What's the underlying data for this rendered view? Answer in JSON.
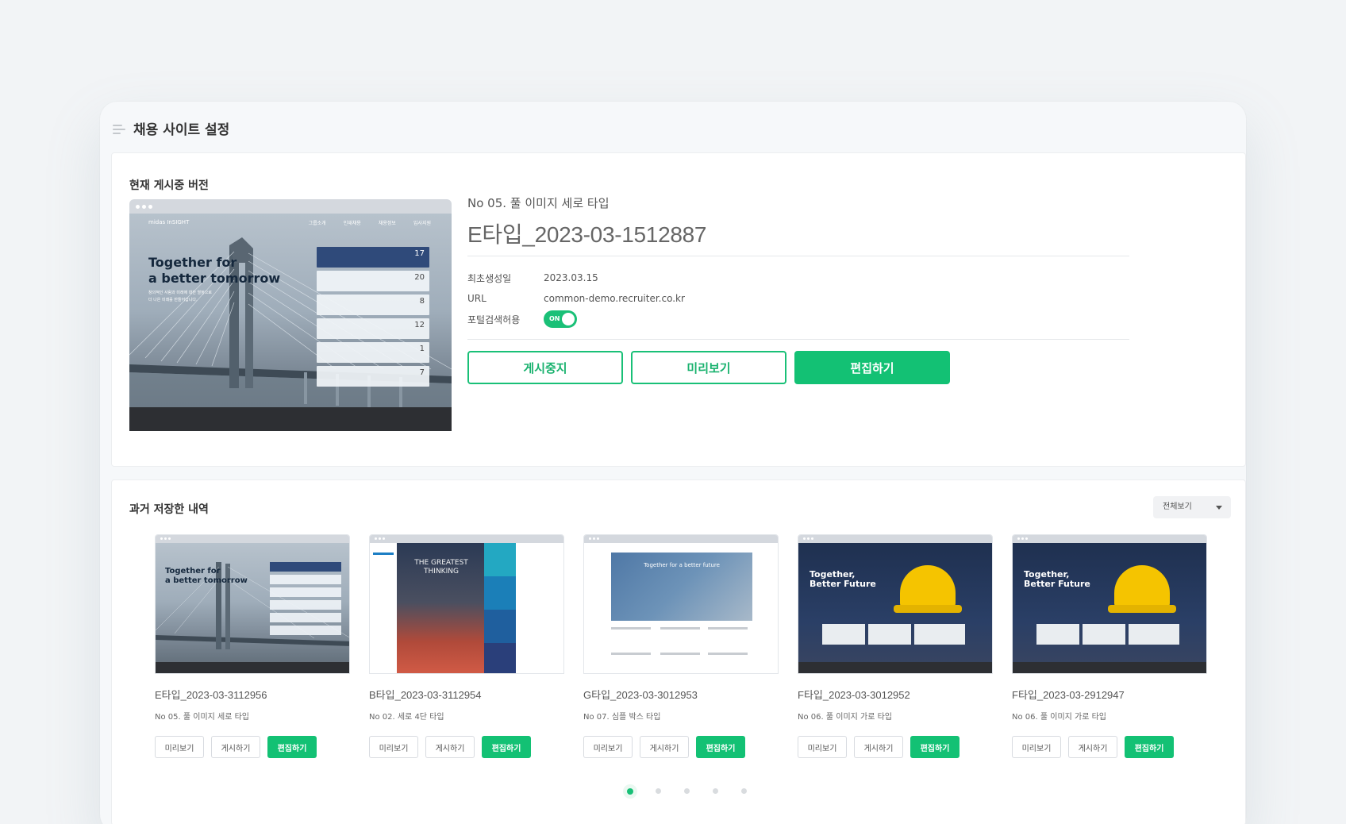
{
  "page": {
    "title": "채용 사이트 설정"
  },
  "current": {
    "section_title": "현재 게시중 버전",
    "preview": {
      "brand": "midas InSIGHT",
      "nav": [
        "그룹소개",
        "인재채용",
        "채용정보",
        "입사지원"
      ],
      "headline_1": "Together for",
      "headline_2": "a better tomorrow",
      "tagline_1": "창의적인 사람과 미래에 대한 열정으로",
      "tagline_2": "더 나은 미래를 만들어갑니다.",
      "list_numbers": [
        "17",
        "20",
        "8",
        "12",
        "1",
        "7"
      ]
    },
    "template_label": "No 05. 풀 이미지 세로 타입",
    "version_name": "E타입_2023-03-1512887",
    "meta": {
      "created_key": "최초생성일",
      "created_val": "2023.03.15",
      "url_key": "URL",
      "url_val": "common-demo.recruiter.co.kr",
      "portal_key": "포털검색허용",
      "toggle_label": "ON"
    },
    "buttons": {
      "stop": "게시중지",
      "preview": "미리보기",
      "edit": "편집하기"
    }
  },
  "history": {
    "section_title": "과거 저장한 내역",
    "filter_label": "전체보기",
    "items": [
      {
        "name": "E타입_2023-03-3112956",
        "sub": "No 05. 풀 이미지 세로 타입",
        "headline": "Together for",
        "headline2": "a better tomorrow"
      },
      {
        "name": "B타입_2023-03-3112954",
        "sub": "No 02. 세로 4단 타입",
        "headline": "THE GREATEST",
        "headline2": "THINKING"
      },
      {
        "name": "G타입_2023-03-3012953",
        "sub": "No 07. 심플 박스 타입",
        "headline": "Together for a better future",
        "headline2": ""
      },
      {
        "name": "F타입_2023-03-3012952",
        "sub": "No 06. 풀 이미지 가로 타입",
        "headline": "Together,",
        "headline2": "Better Future"
      },
      {
        "name": "F타입_2023-03-2912947",
        "sub": "No 06. 풀 이미지 가로 타입",
        "headline": "Together,",
        "headline2": "Better Future"
      }
    ],
    "item_buttons": {
      "preview": "미리보기",
      "publish": "게시하기",
      "edit": "편집하기"
    },
    "pagination": {
      "pages": 5,
      "active": 1
    }
  },
  "colors": {
    "accent": "#13c174",
    "page_bg": "#f2f4f6",
    "panel_bg": "#f6f8fa"
  },
  "icons": {
    "title_icon": "menu-lines-icon",
    "filter_icon": "chevron-down-icon"
  }
}
